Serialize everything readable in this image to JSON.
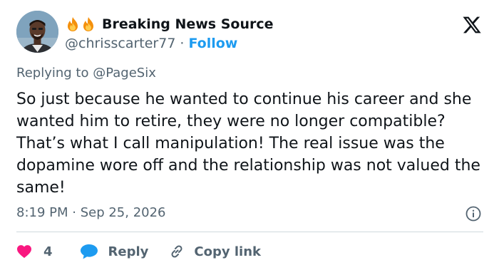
{
  "author": {
    "display_name": "Breaking News Source",
    "handle": "@chrisscarter77",
    "separator": "·",
    "follow_label": "Follow",
    "name_emoji_icons": [
      "fire-icon",
      "fire-icon"
    ]
  },
  "reply_context": {
    "prefix": "Replying to ",
    "mention": "@PageSix"
  },
  "tweet": {
    "text": "So just because he wanted to continue his career and she wanted him to retire, they were no longer compatible? That’s what I call manipulation! The real issue was the dopamine wore off and the relationship was not valued the same!",
    "time": "8:19 PM",
    "separator": " · ",
    "date": "Sep 25, 2026"
  },
  "actions": {
    "like_count": "4",
    "reply_label": "Reply",
    "copy_link_label": "Copy link"
  },
  "icons": {
    "platform_logo": "x-logo-icon",
    "info": "info-icon",
    "like": "heart-icon",
    "reply": "speech-bubble-icon",
    "copy": "link-icon"
  },
  "colors": {
    "text_primary": "#0f1419",
    "text_secondary": "#536471",
    "accent_blue": "#1d9bf0",
    "like_red": "#f91880",
    "divider": "#cfd9de"
  }
}
